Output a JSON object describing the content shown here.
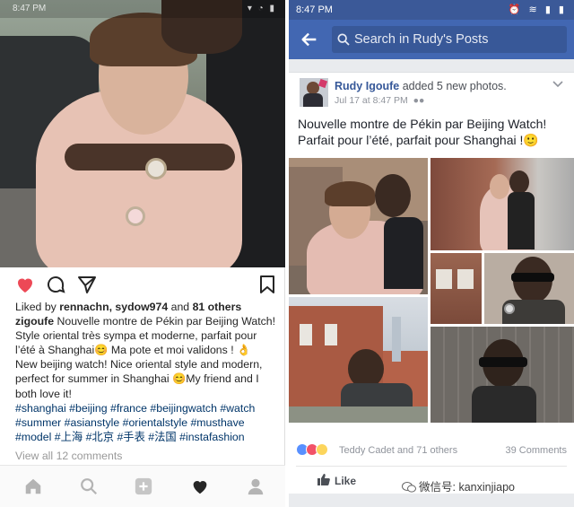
{
  "instagram": {
    "status": {
      "time": "8:47 PM"
    },
    "likes": {
      "prefix": "Liked by",
      "users": "rennachn, sydow974",
      "and": "and",
      "others": "81 others"
    },
    "caption": {
      "username": "zigoufe",
      "line1": "Nouvelle montre de Pékin par Beijing Watch!",
      "line2": "Style oriental très sympa et moderne, parfait pour",
      "line3": "l’été à Shanghai😊 Ma pote et moi validons ! 👌",
      "line4": "New beijing watch! Nice oriental style and modern,",
      "line5": "perfect for summer in Shanghai 😊My friend and I",
      "line6": "both love it!",
      "tags1": "#shanghai #beijing #france #beijingwatch #watch",
      "tags2": "#summer #asianstyle #orientalstyle #musthave",
      "tags3": "#model #上海 #北京 #手表 #法国 #instafashion"
    },
    "view_all": "View all 12 comments",
    "colors": {
      "heart": "#ed4956",
      "link": "#003569"
    },
    "nav_icons": [
      "home-icon",
      "search-icon",
      "add-icon",
      "heart-icon",
      "profile-icon"
    ]
  },
  "facebook": {
    "status": {
      "time": "8:47 PM"
    },
    "search_placeholder": "Search in Rudy's Posts",
    "post": {
      "author": "Rudy Igoufe",
      "action": "added 5 new photos.",
      "date": "Jul 17 at 8:47 PM",
      "message_line1": "Nouvelle montre de Pékin par Beijing Watch!",
      "message_line2": "Parfait pour l’été, parfait pour Shanghai !🙂",
      "reactions_text": "Teddy Cadet and 71 others",
      "comments": "39 Comments",
      "like_label": "Like"
    },
    "colors": {
      "bar": "#4267b2",
      "status": "#3b5998",
      "author": "#365899"
    }
  },
  "watermark": "微信号: kanxinjiapo"
}
